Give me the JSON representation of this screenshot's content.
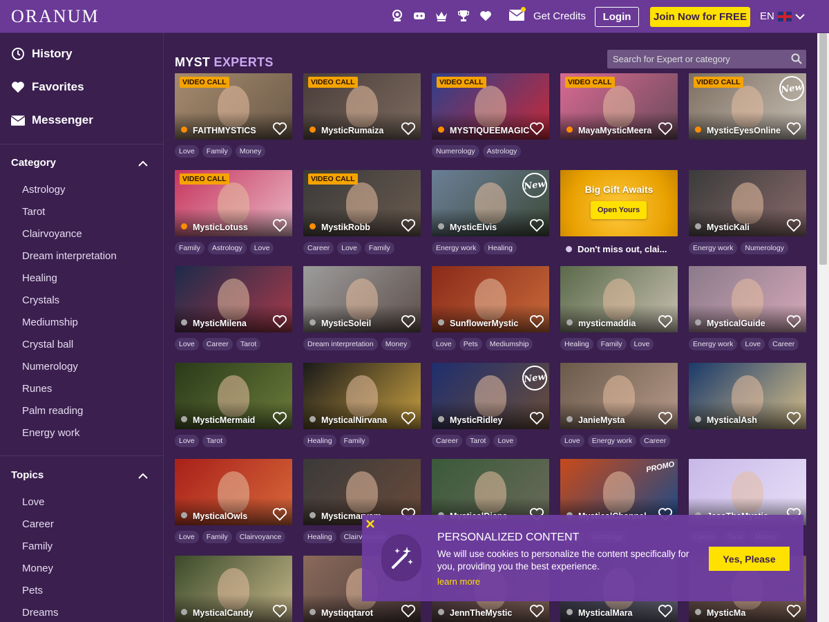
{
  "header": {
    "logo": "ORANUM",
    "get_credits": "Get Credits",
    "login": "Login",
    "join": "Join Now for FREE",
    "language": "EN"
  },
  "sidebar": {
    "links": [
      {
        "label": "History",
        "icon": "history-icon"
      },
      {
        "label": "Favorites",
        "icon": "heart-icon"
      },
      {
        "label": "Messenger",
        "icon": "envelope-icon"
      }
    ],
    "category": {
      "title": "Category",
      "items": [
        "Astrology",
        "Tarot",
        "Clairvoyance",
        "Dream interpretation",
        "Healing",
        "Crystals",
        "Mediumship",
        "Crystal ball",
        "Numerology",
        "Runes",
        "Palm reading",
        "Energy work"
      ]
    },
    "topics": {
      "title": "Topics",
      "items": [
        "Love",
        "Career",
        "Family",
        "Money",
        "Pets",
        "Dreams"
      ]
    }
  },
  "main": {
    "title_part1": "MYST",
    "title_part2": "EXPERTS",
    "search_placeholder": "Search for Expert or category",
    "video_call_label": "VIDEO CALL",
    "new_label": "New",
    "promo_label": "PROMO",
    "gift": {
      "title": "Big Gift Awaits",
      "button": "Open Yours",
      "text": "Don't miss out, clai..."
    },
    "experts": [
      {
        "name": "FAITHMYSTICS",
        "status": "online",
        "video": true,
        "tags": [
          "Love",
          "Family",
          "Money"
        ]
      },
      {
        "name": "MysticRumaiza",
        "status": "online",
        "video": true,
        "tags": []
      },
      {
        "name": "MYSTIQUEEMAGIC",
        "status": "online",
        "video": true,
        "tags": [
          "Numerology",
          "Astrology"
        ]
      },
      {
        "name": "MayaMysticMeera",
        "status": "online",
        "video": true,
        "tags": []
      },
      {
        "name": "MysticEyesOnline",
        "status": "online",
        "video": true,
        "new": true,
        "tags": []
      },
      {
        "name": "MysticLotuss",
        "status": "online",
        "video": true,
        "tags": [
          "Family",
          "Astrology",
          "Love"
        ]
      },
      {
        "name": "MystikRobb",
        "status": "online",
        "video": true,
        "tags": [
          "Career",
          "Love",
          "Family"
        ]
      },
      {
        "name": "MysticElvis",
        "status": "offline",
        "new": true,
        "tags": [
          "Energy work",
          "Healing"
        ]
      },
      {
        "gift": true
      },
      {
        "name": "MysticKali",
        "status": "offline",
        "tags": [
          "Energy work",
          "Numerology"
        ]
      },
      {
        "name": "MysticMilena",
        "status": "offline",
        "tags": [
          "Love",
          "Career",
          "Tarot"
        ]
      },
      {
        "name": "MysticSoleil",
        "status": "offline",
        "tags": [
          "Dream interpretation",
          "Money"
        ]
      },
      {
        "name": "SunflowerMystic",
        "status": "offline",
        "tags": [
          "Love",
          "Pets",
          "Mediumship"
        ]
      },
      {
        "name": "mysticmaddia",
        "status": "offline",
        "tags": [
          "Healing",
          "Family",
          "Love"
        ]
      },
      {
        "name": "MysticalGuide",
        "status": "offline",
        "tags": [
          "Energy work",
          "Love",
          "Career"
        ]
      },
      {
        "name": "MysticMermaid",
        "status": "offline",
        "tags": [
          "Love",
          "Tarot"
        ]
      },
      {
        "name": "MysticalNirvana",
        "status": "offline",
        "tags": [
          "Healing",
          "Family"
        ]
      },
      {
        "name": "MysticRidley",
        "status": "offline",
        "new": true,
        "tags": [
          "Career",
          "Tarot",
          "Love"
        ]
      },
      {
        "name": "JanieMysta",
        "status": "offline",
        "tags": [
          "Love",
          "Energy work",
          "Career"
        ]
      },
      {
        "name": "MysticalAsh",
        "status": "offline",
        "tags": []
      },
      {
        "name": "MysticalOwls",
        "status": "offline",
        "tags": [
          "Love",
          "Family",
          "Clairvoyance"
        ]
      },
      {
        "name": "Mysticmaryam",
        "status": "offline",
        "tags": [
          "Healing",
          "Clairvoyance"
        ]
      },
      {
        "name": "MysticalDiana",
        "status": "offline",
        "tags": []
      },
      {
        "name": "MysticalChannel",
        "status": "offline",
        "promo": true,
        "tags": [
          "Love",
          "Astrology"
        ]
      },
      {
        "name": "JessTheMystic",
        "status": "offline",
        "tags": [
          "Career",
          "Tarot",
          "Money"
        ]
      },
      {
        "name": "MysticalCandy",
        "status": "offline",
        "tags": []
      },
      {
        "name": "Mystiqqtarot",
        "status": "offline",
        "tags": []
      },
      {
        "name": "JennTheMystic",
        "status": "offline",
        "tags": []
      },
      {
        "name": "MysticalMara",
        "status": "offline",
        "tags": []
      },
      {
        "name": "MysticMa",
        "status": "offline",
        "tags": []
      }
    ]
  },
  "cookie": {
    "title": "PERSONALIZED CONTENT",
    "text": "We will use cookies to personalize the content specifically for you, providing you the best experience.",
    "link": "learn more",
    "button": "Yes, Please"
  },
  "colors": {
    "header_bg": "#6a3a96",
    "page_bg": "#3a1f4f",
    "accent_yellow": "#ffe100",
    "video_badge": "#f5a300",
    "online_dot": "#ff8c00"
  }
}
